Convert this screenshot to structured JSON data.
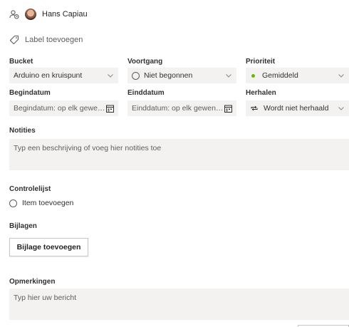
{
  "assignment": {
    "name": "Hans Capiau"
  },
  "label": {
    "text": "Label toevoegen"
  },
  "fields": {
    "bucket": {
      "label": "Bucket",
      "value": "Arduino en kruispunt"
    },
    "progress": {
      "label": "Voortgang",
      "value": "Niet begonnen"
    },
    "priority": {
      "label": "Prioriteit",
      "value": "Gemiddeld",
      "color": "#6bb700"
    },
    "start_date": {
      "label": "Begindatum",
      "placeholder": "Begindatum: op elk gewens..."
    },
    "due_date": {
      "label": "Einddatum",
      "placeholder": "Einddatum: op elk gewenst ..."
    },
    "repeat": {
      "label": "Herhalen",
      "value": "Wordt niet herhaald"
    }
  },
  "notes": {
    "label": "Notities",
    "placeholder": "Typ een beschrijving of voeg hier notities toe"
  },
  "checklist": {
    "label": "Controlelijst",
    "add_item": "Item toevoegen"
  },
  "attachments": {
    "label": "Bijlagen",
    "add_button": "Bijlage toevoegen"
  },
  "comments": {
    "label": "Opmerkingen",
    "placeholder": "Typ hier uw bericht"
  }
}
